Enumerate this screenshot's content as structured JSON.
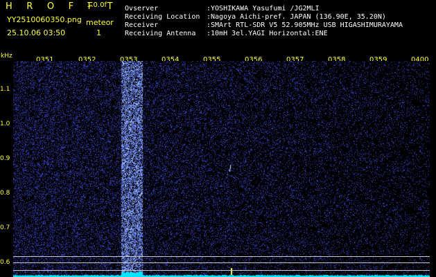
{
  "header": {
    "brand": "HROFFT",
    "version": "1.0.0f",
    "filename": "YY2510060350.png",
    "type_label": "meteor",
    "datetime": "25.10.06 03:50",
    "meteor_count": "1"
  },
  "station": {
    "rows": [
      {
        "label": "Ovserver",
        "value": ":YOSHIKAWA Yasufumi /JG2MLI"
      },
      {
        "label": "Receiving Location",
        "value": ":Nagoya Aichi-pref. JAPAN (136.90E, 35.20N)"
      },
      {
        "label": "Receiver",
        "value": ":SMArt RTL-SDR V5 52.905MHz USB HIGASHIMURAYAMA"
      },
      {
        "label": "Receiving Antenna",
        "value": ":10mH 3el.YAGI Horizontal:ENE"
      }
    ]
  },
  "axes": {
    "unit": "kHz",
    "y_ticks": [
      "1.1",
      "1.0",
      "0.9",
      "0.8",
      "0.7",
      "0.6"
    ],
    "x_ticks": [
      "0351",
      "0352",
      "0353",
      "0354",
      "0355",
      "0356",
      "0357",
      "0358",
      "0359",
      "0400"
    ]
  },
  "colors": {
    "background": "#000000",
    "header_text": "#ffff33",
    "info_text": "#ffffff",
    "spectrum_noise": "#2b33a8",
    "meteor_band": "#4c69ff",
    "baseline": "#00e5ff"
  }
}
